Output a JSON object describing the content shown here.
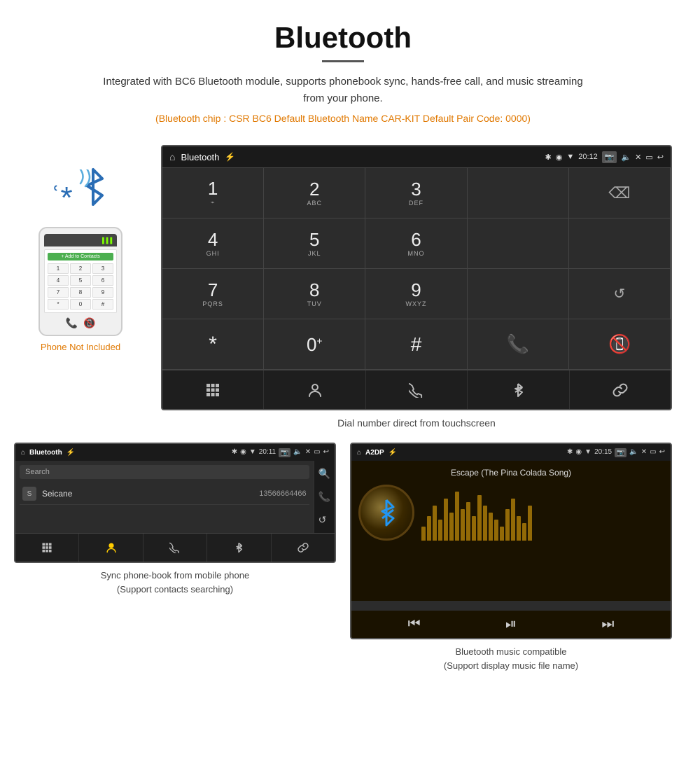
{
  "header": {
    "title": "Bluetooth",
    "description": "Integrated with BC6 Bluetooth module, supports phonebook sync, hands-free call, and music streaming from your phone.",
    "specs": "(Bluetooth chip : CSR BC6    Default Bluetooth Name CAR-KIT    Default Pair Code: 0000)"
  },
  "phone": {
    "not_included": "Phone Not Included",
    "contacts_btn": "+ Add to Contacts"
  },
  "car_screen": {
    "status": {
      "app_name": "Bluetooth",
      "time": "20:12"
    },
    "dialpad": [
      {
        "num": "1",
        "sub": ""
      },
      {
        "num": "2",
        "sub": "ABC"
      },
      {
        "num": "3",
        "sub": "DEF"
      },
      {
        "num": "",
        "sub": ""
      },
      {
        "num": "⌫",
        "sub": ""
      },
      {
        "num": "4",
        "sub": "GHI"
      },
      {
        "num": "5",
        "sub": "JKL"
      },
      {
        "num": "6",
        "sub": "MNO"
      },
      {
        "num": "",
        "sub": ""
      },
      {
        "num": "",
        "sub": ""
      },
      {
        "num": "7",
        "sub": "PQRS"
      },
      {
        "num": "8",
        "sub": "TUV"
      },
      {
        "num": "9",
        "sub": "WXYZ"
      },
      {
        "num": "",
        "sub": ""
      },
      {
        "num": "↺",
        "sub": ""
      },
      {
        "num": "*",
        "sub": ""
      },
      {
        "num": "0",
        "sub": "+"
      },
      {
        "num": "#",
        "sub": ""
      },
      {
        "num": "✆",
        "sub": ""
      },
      {
        "num": "✆end",
        "sub": ""
      }
    ],
    "bottom_nav": [
      "⊞",
      "👤",
      "✆",
      "✱",
      "🔗"
    ]
  },
  "dial_caption": "Dial number direct from touchscreen",
  "contacts_screen": {
    "status_app": "Bluetooth",
    "status_time": "20:11",
    "search_placeholder": "Search",
    "contacts": [
      {
        "letter": "S",
        "name": "Seicane",
        "number": "13566664466"
      }
    ],
    "side_icons": [
      "🔍",
      "✆",
      "↺"
    ],
    "bottom_nav": [
      "⊞",
      "👤",
      "✆",
      "✱",
      "🔗"
    ]
  },
  "contacts_caption": "Sync phone-book from mobile phone\n(Support contacts searching)",
  "music_screen": {
    "status_app": "A2DP",
    "status_time": "20:15",
    "song_title": "Escape (The Pina Colada Song)",
    "controls": [
      "⏮",
      "⏯",
      "⏭"
    ]
  },
  "music_caption": "Bluetooth music compatible\n(Support display music file name)"
}
